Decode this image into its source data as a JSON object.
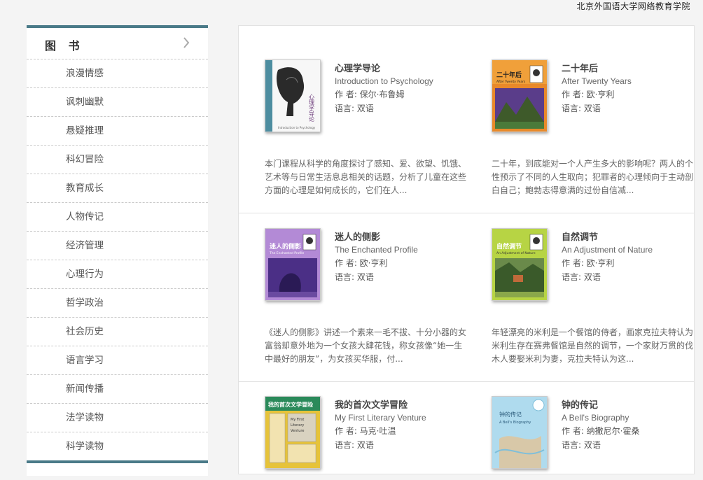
{
  "brand": "北京外国语大学网络教育学院",
  "sidebar": {
    "title": "图 书",
    "items": [
      "浪漫情感",
      "讽刺幽默",
      "悬疑推理",
      "科幻冒险",
      "教育成长",
      "人物传记",
      "经济管理",
      "心理行为",
      "哲学政治",
      "社会历史",
      "语言学习",
      "新闻传播",
      "法学读物",
      "科学读物"
    ]
  },
  "books": [
    {
      "title": "心理学导论",
      "english": "Introduction to Psychology",
      "author": "作 者: 保尔·布鲁姆",
      "language": "语言: 双语",
      "description": "本门课程从科学的角度探讨了感知、爱、欲望、饥饿、艺术等与日常生活息息相关的话题，分析了儿童在这些方面的心理是如何成长的，它们在人..."
    },
    {
      "title": "二十年后",
      "english": "After Twenty Years",
      "author": "作 者: 欧·亨利",
      "language": "语言: 双语",
      "description": "二十年，到底能对一个人产生多大的影响呢？两人的个性预示了不同的人生取向；犯罪者的心理倾向于主动剖白自己；鲍勃志得意满的过份自信减..."
    },
    {
      "title": "迷人的侧影",
      "english": "The Enchanted Profile",
      "author": "作 者: 欧·亨利",
      "language": "语言: 双语",
      "description": "《迷人的侧影》讲述一个素来一毛不拔、十分小器的女富翁却意外地为一个女孩大肆花钱，称女孩像“她一生中最好的朋友”，为女孩买华服，付..."
    },
    {
      "title": "自然调节",
      "english": "An Adjustment of Nature",
      "author": "作 者: 欧·亨利",
      "language": "语言: 双语",
      "description": "年轻漂亮的米利是一个餐馆的侍者，画家克拉夫特认为米利生存在赛弗餐馆是自然的调节，一个家财万贯的伐木人要娶米利为妻，克拉夫特认为这..."
    },
    {
      "title": "我的首次文学冒险",
      "english": "My First Literary Venture",
      "author": "作 者: 马克·吐温",
      "language": "语言: 双语",
      "description": ""
    },
    {
      "title": "钟的传记",
      "english": "A Bell's Biography",
      "author": "作 者: 纳撒尼尔·霍桑",
      "language": "语言: 双语",
      "description": ""
    }
  ],
  "covers": {
    "psych": {
      "text": "心理学导论",
      "sub": "Introduction to Psychology"
    },
    "twenty": {
      "text": "二十年后",
      "sub": "After Twenty Years"
    },
    "enchanted": {
      "text": "迷人的侧影",
      "sub": "The Enchanted Profile"
    },
    "nature": {
      "text": "自然调节",
      "sub": "An Adjustment of Nature"
    },
    "venture": {
      "text": "我的首次文学冒险",
      "sub": "My First Literary Venture"
    },
    "bell": {
      "text": "钟的传记",
      "sub": "A Bell's Biography"
    }
  },
  "colors": {
    "accent": "#4a7a88",
    "cover_purple": "#5a3d8a",
    "cover_orange": "#e07a20",
    "cover_green": "#a9c83a",
    "cover_yellow": "#e6c33a",
    "cover_blue": "#9fd4ea"
  }
}
